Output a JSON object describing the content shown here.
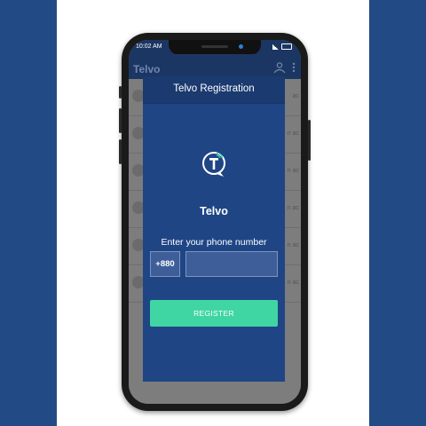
{
  "colors": {
    "brand_blue": "#224a85",
    "dialog_blue": "#1f4585",
    "accent_green": "#3fd6a4",
    "overlay_gray": "#7d7d7d"
  },
  "status_bar": {
    "time": "10:02 AM"
  },
  "app_bar": {
    "title": "Telvo",
    "icon": "contact-sync-icon",
    "menu_icon": "overflow-menu-icon"
  },
  "background_list": {
    "items": [
      {
        "snippet": "ac"
      },
      {
        "snippet": "n ac"
      },
      {
        "snippet": "n ac"
      },
      {
        "snippet": "n ac"
      },
      {
        "snippet": "n ac"
      },
      {
        "snippet": "n ac"
      }
    ]
  },
  "dialog": {
    "title": "Telvo Registration",
    "logo_icon": "telvo-logo-icon",
    "brand_name": "Telvo",
    "prompt": "Enter your phone number",
    "country_code": "+880",
    "phone_value": "",
    "phone_placeholder": "",
    "register_label": "REGISTER"
  }
}
